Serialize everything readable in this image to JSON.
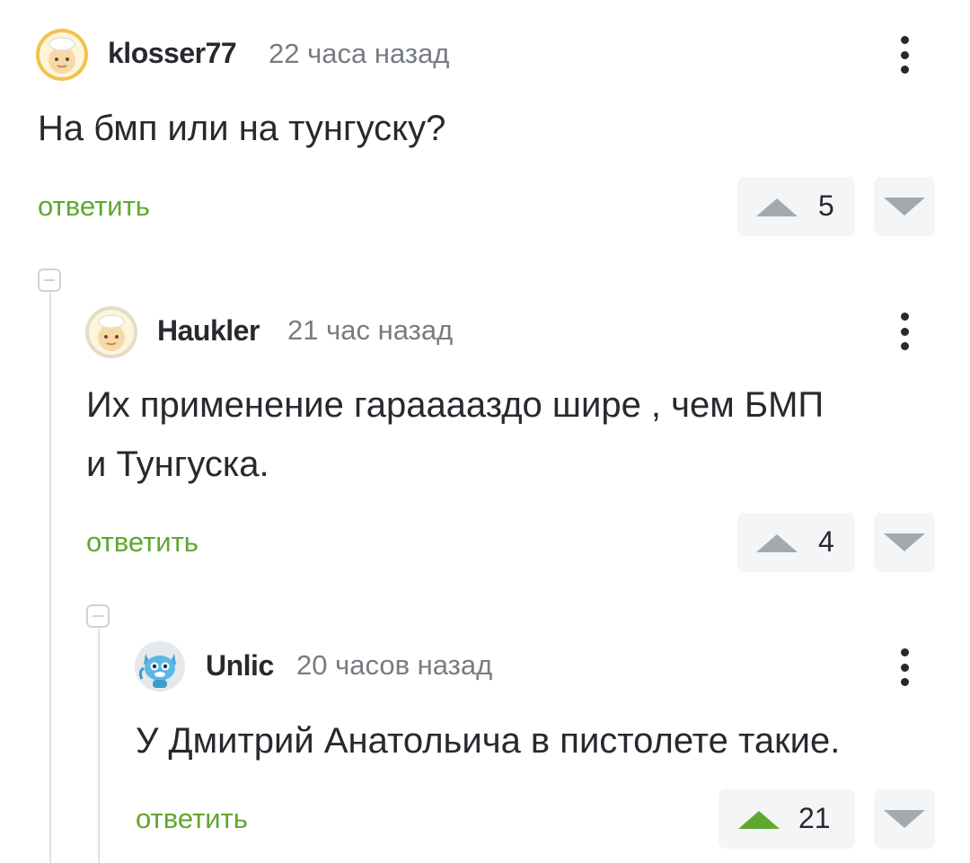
{
  "comments": [
    {
      "author": "klosser77",
      "time": "22 часа назад",
      "text_lines": [
        "На бмп или на тунгуску?"
      ],
      "reply_label": "ответить",
      "votes": "5",
      "upvoted": false
    },
    {
      "author": "Haukler",
      "time": "21 час назад",
      "text_lines": [
        "Их применение гарааааздо шире , чем БМП",
        "и Тунгуска."
      ],
      "reply_label": "ответить",
      "votes": "4",
      "upvoted": false
    },
    {
      "author": "Unlic",
      "time": "20 часов назад",
      "text_lines": [
        "У Дмитрий Анатольича в пистолете такие."
      ],
      "reply_label": "ответить",
      "votes": "21",
      "upvoted": true
    }
  ],
  "colors": {
    "reply": "#5fa82f",
    "vote_neutral": "#a4a9ae",
    "vote_active": "#5fa82f",
    "vote_bg": "#f4f5f6",
    "avatar_ring": "#f3c24a"
  },
  "icons": {
    "avatar_default": "cook-face-icon",
    "avatar_cat": "blue-cat-icon",
    "more": "more-vertical-icon",
    "upvote": "triangle-up-icon",
    "downvote": "triangle-down-icon",
    "collapse": "collapse-minus-icon"
  }
}
